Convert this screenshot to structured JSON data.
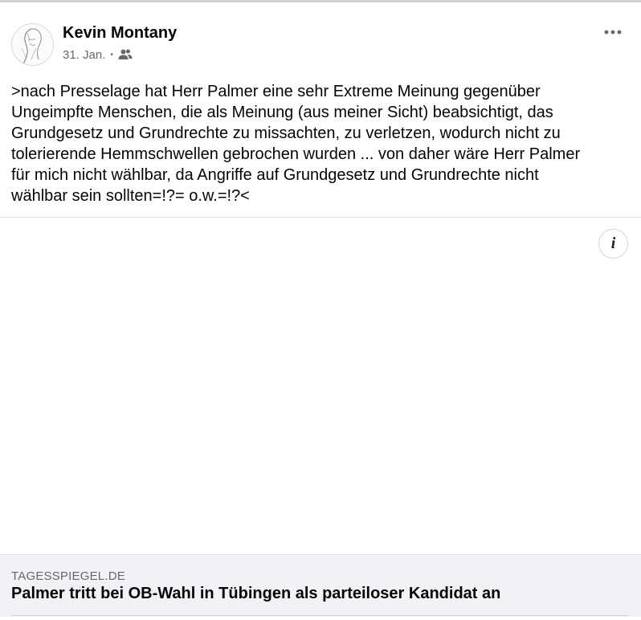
{
  "post": {
    "author": "Kevin Montany",
    "date": "31. Jan.",
    "separator": "•",
    "audience_icon": "friends-icon",
    "more_icon": "more-options-icon",
    "text_lines": [
      ">nach Presselage hat Herr Palmer eine sehr Extreme Meinung gegenüber",
      "Ungeimpfte Menschen, die als Meinung (aus meiner Sicht) beabsichtigt,  das",
      "Grundgesetz und Grundrechte zu missachten, zu verletzen, wodurch nicht zu",
      "tolerierende Hemmschwellen gebrochen wurden  ... von daher wäre Herr Palmer",
      "für mich nicht wählbar, da Angriffe auf Grundgesetz und Grundrechte nicht",
      "wählbar sein sollten=!?= o.w.=!?<"
    ]
  },
  "media": {
    "info_label": "i"
  },
  "link_preview": {
    "domain": "TAGESSPIEGEL.DE",
    "title": "Palmer tritt bei OB-Wahl in Tübingen als parteiloser Kandidat an"
  }
}
